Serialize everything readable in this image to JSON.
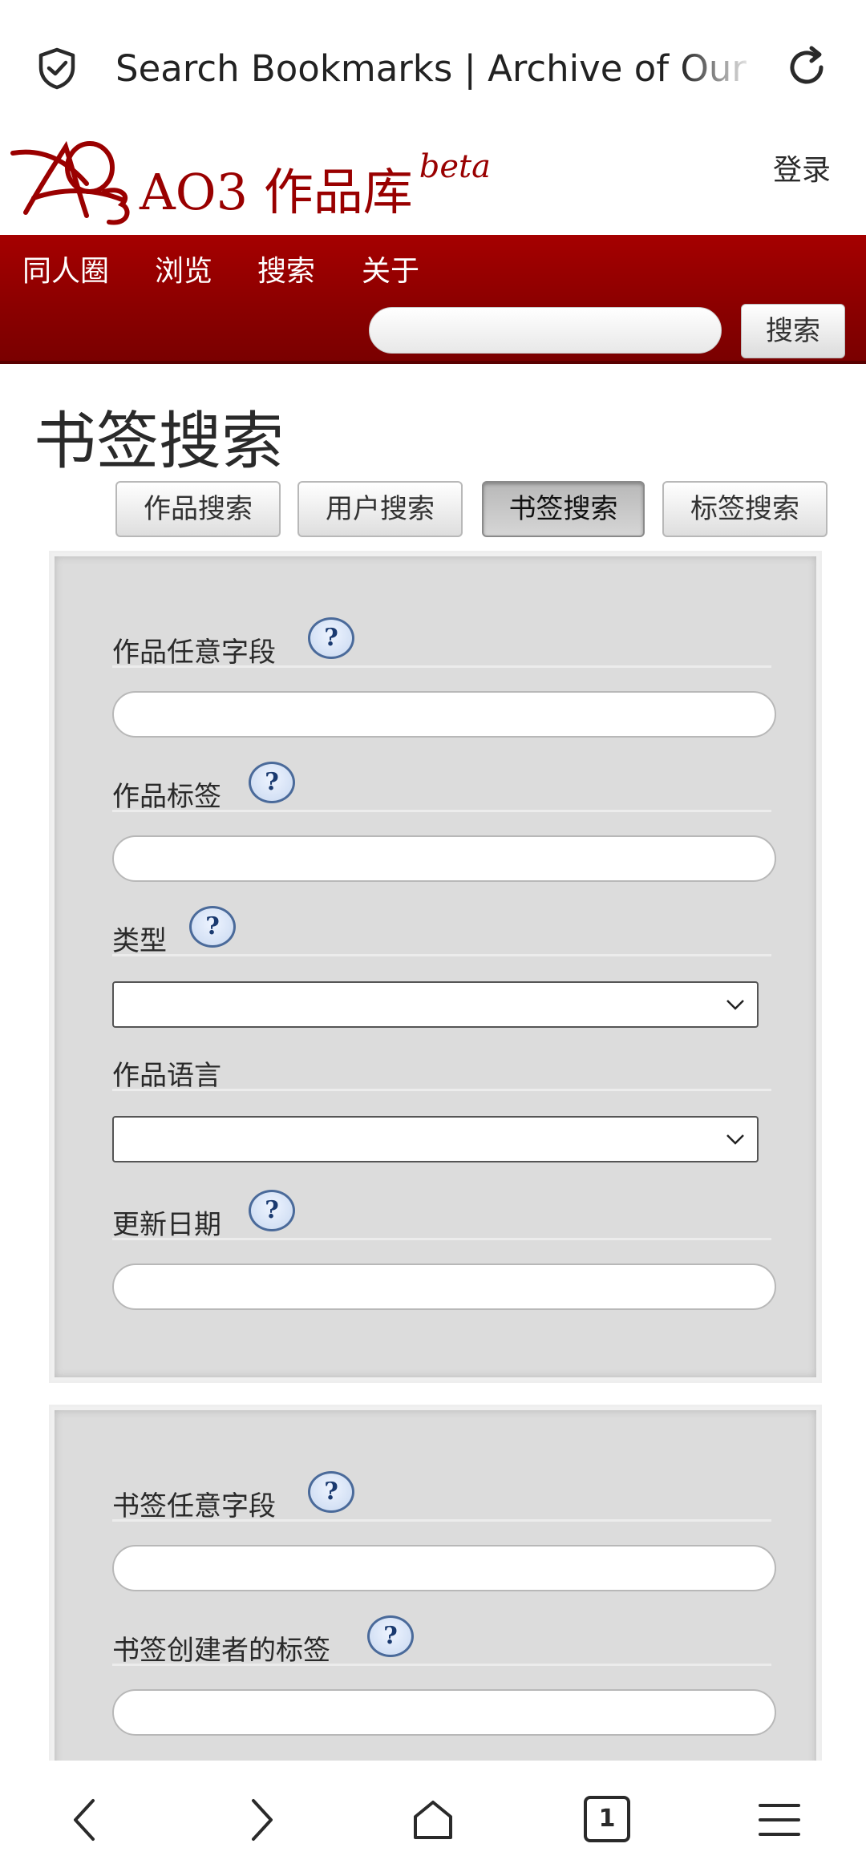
{
  "browser": {
    "tab_title": "Search Bookmarks | Archive of Our Own"
  },
  "site": {
    "logo_text": "AO3 作品库",
    "logo_beta": "beta",
    "login_label": "登录"
  },
  "nav": {
    "items": [
      "同人圈",
      "浏览",
      "搜索",
      "关于"
    ],
    "search_button": "搜索",
    "search_placeholder": ""
  },
  "page": {
    "heading": "书签搜索",
    "tabs": [
      {
        "label": "作品搜索",
        "current": false
      },
      {
        "label": "用户搜索",
        "current": false
      },
      {
        "label": "书签搜索",
        "current": true
      },
      {
        "label": "标签搜索",
        "current": false
      }
    ]
  },
  "work_panel": {
    "any_field_label": "作品任意字段",
    "tags_label": "作品标签",
    "type_label": "类型",
    "language_label": "作品语言",
    "date_label": "更新日期",
    "help_glyph": "?",
    "type_value": "",
    "language_value": ""
  },
  "bookmark_panel": {
    "any_field_label": "书签任意字段",
    "creator_tags_label": "书签创建者的标签"
  },
  "bottom_bar": {
    "tab_count": "1"
  },
  "colors": {
    "brand_red": "#990000",
    "panel_gray": "#dcdcdc",
    "help_blue": "#4a6a9a"
  }
}
